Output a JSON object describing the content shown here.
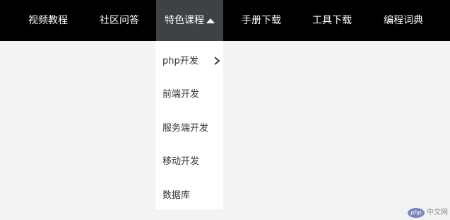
{
  "nav": {
    "items": [
      {
        "label": "视频教程"
      },
      {
        "label": "社区问答"
      },
      {
        "label": "特色课程",
        "active": true
      },
      {
        "label": "手册下载"
      },
      {
        "label": "工具下载"
      },
      {
        "label": "编程词典"
      }
    ]
  },
  "dropdown": {
    "items": [
      {
        "label": "php开发",
        "has_submenu": true
      },
      {
        "label": "前端开发"
      },
      {
        "label": "服务端开发"
      },
      {
        "label": "移动开发"
      },
      {
        "label": "数据库"
      }
    ]
  },
  "watermark": {
    "logo_text": "php",
    "site_text": "中文网"
  },
  "colors": {
    "navbar_bg": "#000000",
    "active_tab_bg": "#3e4245",
    "page_bg": "#f2f3f5",
    "dropdown_bg": "#ffffff",
    "nav_text": "#ffffff",
    "dropdown_text": "#333333"
  },
  "icons": {
    "caret": "caret-up-icon",
    "submenu": "chevron-right-icon"
  }
}
